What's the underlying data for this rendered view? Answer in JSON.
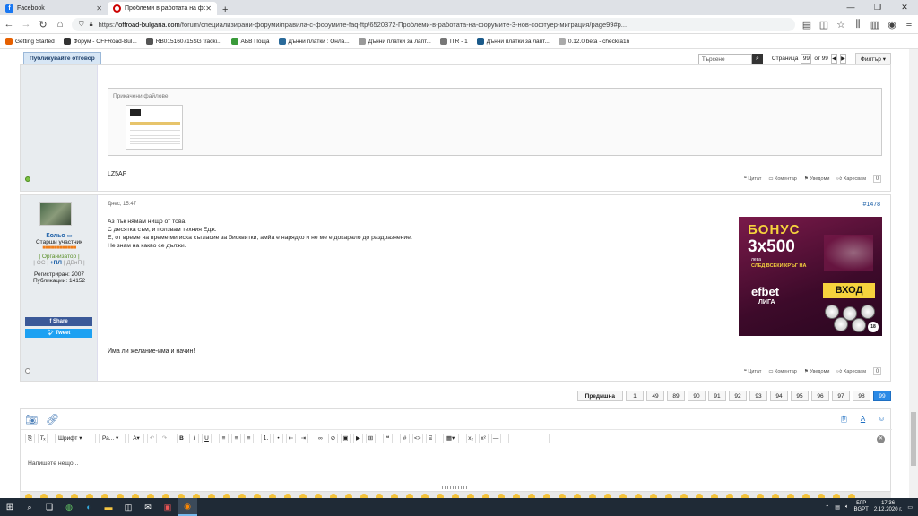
{
  "browser": {
    "tabs": [
      {
        "title": "Facebook"
      },
      {
        "title": "Проблеми в работата на фо..."
      }
    ],
    "url_prefix": "https://",
    "url_host": "offroad-bulgaria.com",
    "url_path": "/forum/специализирани-форуми/правила-с-форумите-faq-ftp/6520372-Проблеми-в-работата-на-форумите-3-нов-софтуер-миграция/page99#p...",
    "bookmarks": [
      "Getting Started",
      "Форум - OFFRoad-Bul...",
      "RB015160715SG tracki...",
      "АБВ Поща",
      "Дънни платки : Онла...",
      "Дънни платки за лапт...",
      "ITR - 1",
      "Дънни платки за лапт...",
      "0.12.0 beta - checkra1n"
    ]
  },
  "toolbar": {
    "publish_label": "Публикувайте отговор",
    "search_placeholder": "Търсене",
    "page_label": "Страница",
    "page_current": "99",
    "page_of": "от 99",
    "filter_label": "Филтър"
  },
  "post1": {
    "attachments_title": "Прикачени файлове",
    "signature": "LZ5AF",
    "actions": {
      "quote": "Цитат",
      "comment": "Коментар",
      "notify": "Уведоми",
      "like": "Харесвам",
      "count": "0"
    }
  },
  "post2": {
    "date": "Днес, 15:47",
    "number": "#1478",
    "user": {
      "name": "Кольо",
      "rank": "Старши участник",
      "role": "| Организатор |",
      "groups_prefix": "| ОС |",
      "groups_mid": "+ПЛ",
      "groups_suffix": "| ДВнП |",
      "registered": "Регистриран: 2007",
      "posts": "Публикации: 14152",
      "share": "Share",
      "tweet": "Tweet"
    },
    "text_lines": [
      "Аз пък нямам нищо от това.",
      "С десятка съм, и ползвам техния Едж.",
      "Е, от време на време ми иска съгласие за бисквитки, амйа е нарядко и не ме е докарало до раздразнение.",
      "Не знам на какво се дължи."
    ],
    "signature": "Има ли желание-има и начин!",
    "actions": {
      "quote": "Цитат",
      "comment": "Коментар",
      "notify": "Уведоми",
      "like": "Харесвам",
      "count": "0"
    }
  },
  "ad": {
    "line1": "БОНУС",
    "line2": "3x500",
    "line3": "лева",
    "line4": "СЛЕД ВСЕКИ КРЪГ НА",
    "brand": "efbet",
    "league": "ЛИГА",
    "cta": "ВХОД",
    "age": "18"
  },
  "pagination": {
    "prev": "Предишна",
    "pages": [
      "1",
      "49",
      "89",
      "90",
      "91",
      "92",
      "93",
      "94",
      "95",
      "96",
      "97",
      "98"
    ],
    "current": "99"
  },
  "editor": {
    "font_label": "Шрифт",
    "size_label": "Ра...",
    "placeholder": "Напишете нещо..."
  },
  "taskbar": {
    "lang": "БГР",
    "lang2": "BGPT",
    "time": "17:36",
    "date": "2.12.2020 г."
  },
  "colors": {
    "accent": "#2b8ae6",
    "link": "#1b5fa7",
    "sidebar": "#e8ecef"
  }
}
